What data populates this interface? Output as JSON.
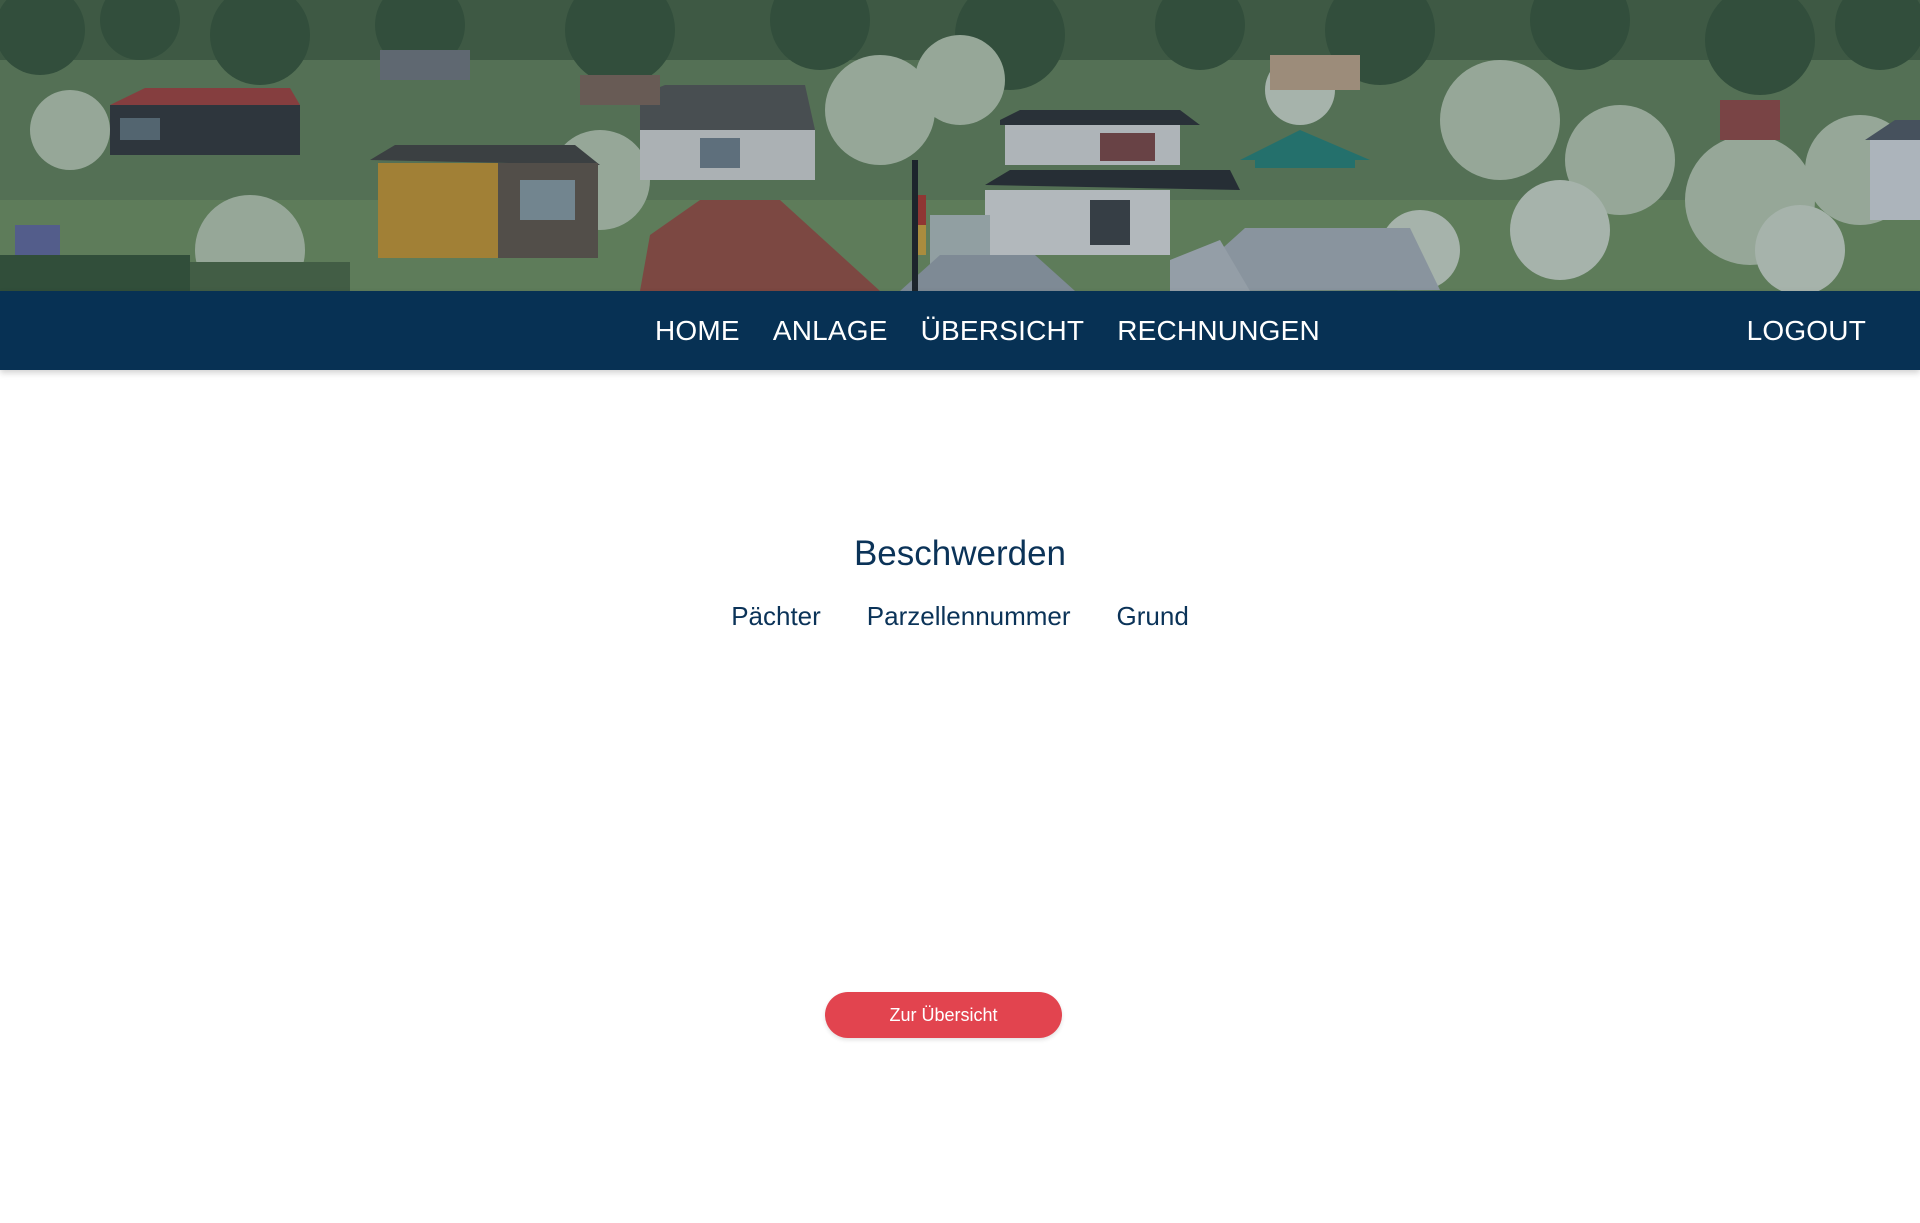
{
  "nav": {
    "items": [
      {
        "label": "HOME"
      },
      {
        "label": "ANLAGE"
      },
      {
        "label": "ÜBERSICHT"
      },
      {
        "label": "RECHNUNGEN"
      }
    ],
    "logout_label": "LOGOUT"
  },
  "main": {
    "title": "Beschwerden",
    "columns": [
      "Pächter",
      "Parzellennummer",
      "Grund"
    ],
    "back_button_label": "Zur Übersicht"
  },
  "colors": {
    "navbar": "#073154",
    "text_primary": "#0b3358",
    "button": "#e2444f"
  }
}
